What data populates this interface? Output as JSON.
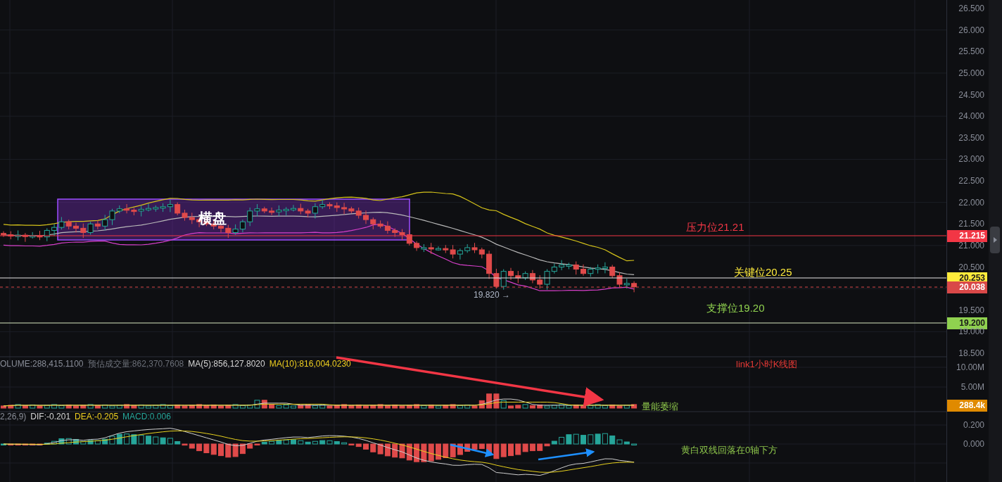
{
  "price_axis": {
    "ticks": [
      "26.500",
      "26.000",
      "25.500",
      "25.000",
      "24.500",
      "24.000",
      "23.500",
      "23.000",
      "22.500",
      "22.000",
      "21.500",
      "21.000",
      "20.500",
      "19.500",
      "19.000",
      "18.500"
    ]
  },
  "range_box": {
    "label": "横盘"
  },
  "low_marker": {
    "text": "19.820 →"
  },
  "levels": [
    {
      "kind": "resistance",
      "label": "压力位21.21",
      "tag": "21.215",
      "color": "#f23645"
    },
    {
      "kind": "key",
      "label": "关键位20.25",
      "tag": "20.253",
      "color": "#ffeb3b"
    },
    {
      "kind": "current",
      "tag": "20.038",
      "color": "#d94848"
    },
    {
      "kind": "support",
      "label": "支撑位19.20",
      "tag": "19.200",
      "color": "#8fd14f"
    }
  ],
  "volume_pane": {
    "legend": [
      {
        "kind": "value",
        "text": "OLUME:288,415.1100"
      },
      {
        "kind": "estimate",
        "text": "预估成交量:862,370.7608"
      },
      {
        "kind": "ma5",
        "text": "MA(5):856,127.8020"
      },
      {
        "kind": "ma10",
        "text": "MA(10):816,004.0230"
      }
    ],
    "axis": [
      "10.00M",
      "5.00M"
    ],
    "tag": "288.4k"
  },
  "macd_pane": {
    "legend": [
      {
        "kind": "params",
        "text": "2,26,9)"
      },
      {
        "kind": "dif",
        "text": "DIF:-0.201"
      },
      {
        "kind": "dea",
        "text": "DEA:-0.205"
      },
      {
        "kind": "macd",
        "text": "MACD:0.006"
      }
    ],
    "axis": [
      "0.200",
      "0.000"
    ]
  },
  "notes": [
    {
      "kind": "title",
      "text": "link1小时K线图",
      "color": "#e53935"
    },
    {
      "kind": "volume",
      "text": "量能萎缩",
      "color": "#8bc34a"
    },
    {
      "kind": "macd",
      "text": "黄白双线回落在0轴下方",
      "color": "#8bc34a"
    }
  ]
}
